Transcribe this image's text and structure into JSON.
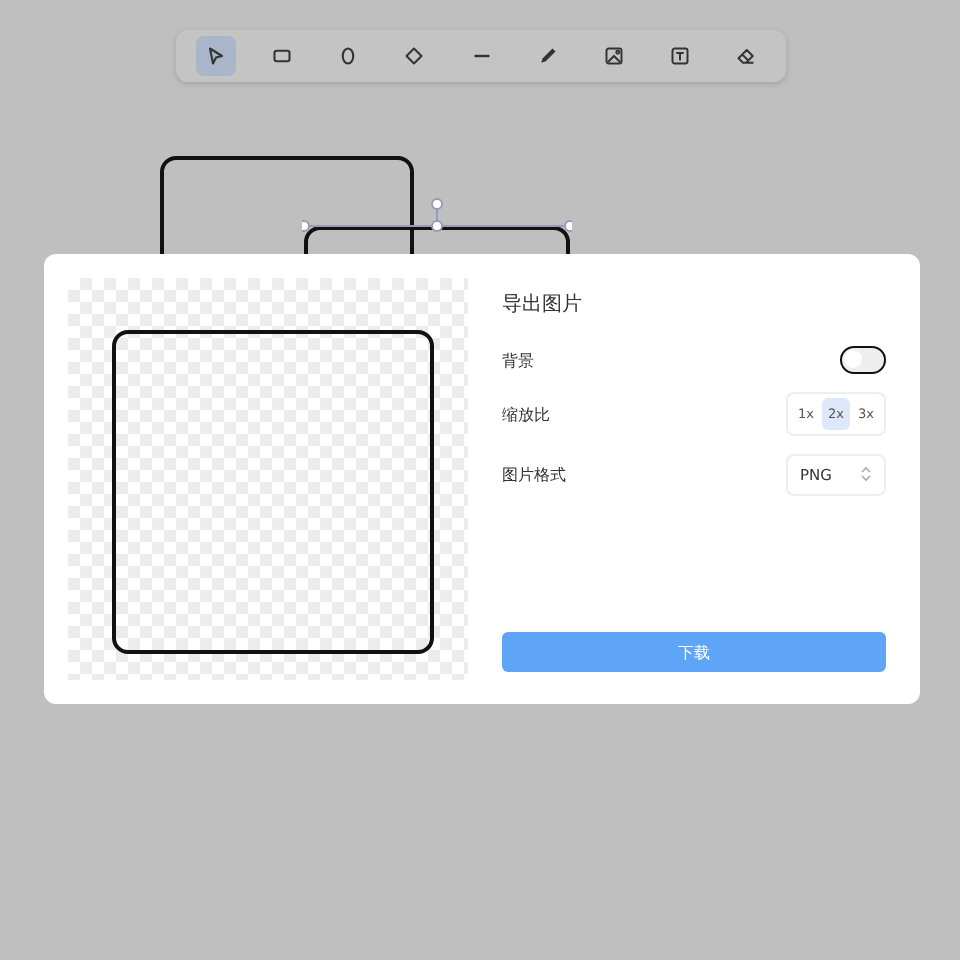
{
  "toolbar": {
    "tools": [
      {
        "kind": "select",
        "selected": true
      },
      {
        "kind": "rectangle",
        "selected": false
      },
      {
        "kind": "ellipse",
        "selected": false
      },
      {
        "kind": "diamond",
        "selected": false
      },
      {
        "kind": "line",
        "selected": false
      },
      {
        "kind": "pencil",
        "selected": false
      },
      {
        "kind": "image",
        "selected": false
      },
      {
        "kind": "text",
        "selected": false
      },
      {
        "kind": "eraser",
        "selected": false
      }
    ]
  },
  "export_dialog": {
    "title": "导出图片",
    "rows": [
      {
        "kind": "toggle",
        "label": "背景",
        "on": false
      },
      {
        "kind": "segmented",
        "label": "缩放比",
        "options": [
          {
            "label": "1x",
            "selected": false
          },
          {
            "label": "2x",
            "selected": true
          },
          {
            "label": "3x",
            "selected": false
          }
        ]
      },
      {
        "kind": "select",
        "label": "图片格式",
        "value": "PNG"
      }
    ],
    "button": "下载"
  }
}
